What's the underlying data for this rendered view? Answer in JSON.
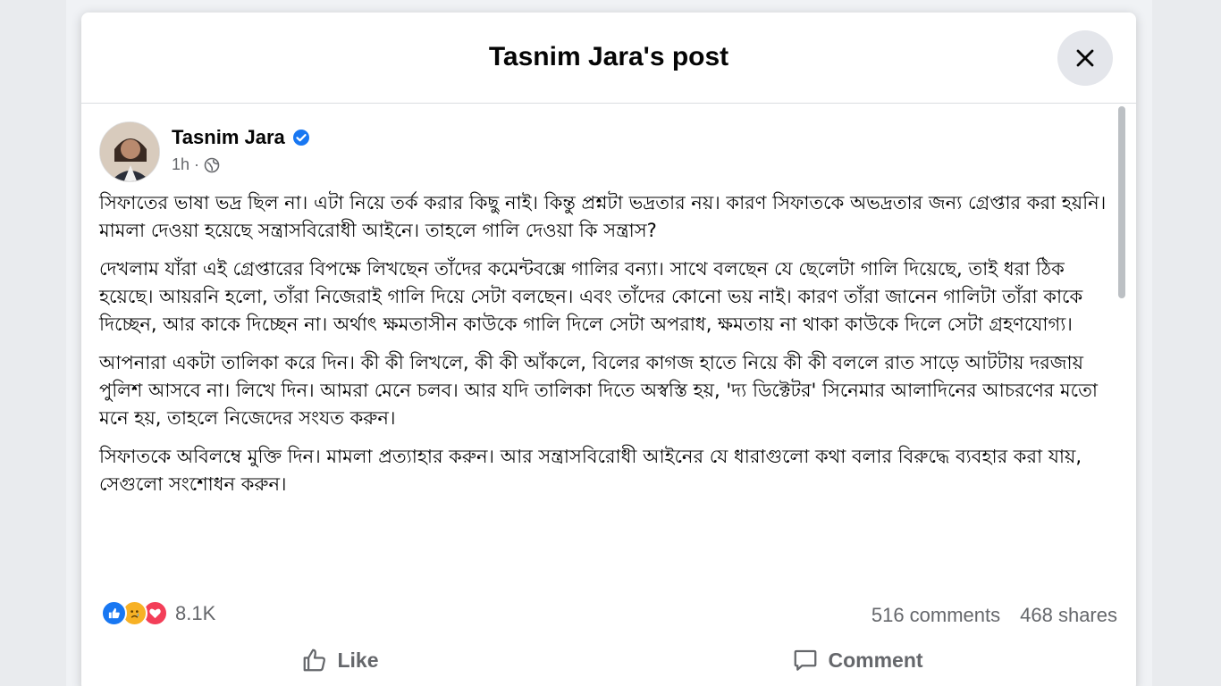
{
  "modal": {
    "title": "Tasnim Jara's post"
  },
  "post": {
    "author": "Tasnim Jara",
    "time": "1h",
    "separator": "·",
    "paragraphs": [
      "সিফাতের ভাষা ভদ্র ছিল না। এটা নিয়ে তর্ক করার কিছু নাই। কিন্তু প্রশ্নটা ভদ্রতার নয়। কারণ সিফাতকে অভদ্রতার জন্য গ্রেপ্তার করা হয়নি। মামলা দেওয়া হয়েছে সন্ত্রাসবিরোধী আইনে। তাহলে গালি দেওয়া কি সন্ত্রাস?",
      "দেখলাম যাঁরা এই গ্রেপ্তারের বিপক্ষে লিখছেন তাঁদের কমেন্টবক্সে গালির বন্যা। সাথে বলছেন যে ছেলেটা গালি দিয়েছে, তাই ধরা ঠিক হয়েছে। আয়রনি হলো, তাঁরা নিজেরাই গালি দিয়ে সেটা বলছেন। এবং তাঁদের কোনো ভয় নাই। কারণ তাঁরা জানেন গালিটা তাঁরা কাকে দিচ্ছেন, আর কাকে দিচ্ছেন না। অর্থাৎ ক্ষমতাসীন কাউকে গালি দিলে সেটা অপরাধ, ক্ষমতায় না থাকা কাউকে দিলে সেটা গ্রহণযোগ্য।",
      "আপনারা একটা তালিকা করে দিন। কী কী লিখলে, কী কী আঁকলে, বিলের কাগজ হাতে নিয়ে কী কী বললে রাত সাড়ে আটটায় দরজায় পুলিশ আসবে না। লিখে দিন। আমরা মেনে চলব। আর যদি তালিকা দিতে অস্বস্তি হয়, 'দ্য ডিক্টেটর' সিনেমার আলাদিনের আচরণের মতো মনে হয়, তাহলে নিজেদের সংযত করুন।",
      "সিফাতকে অবিলম্বে মুক্তি দিন। মামলা প্রত্যাহার করুন। আর সন্ত্রাসবিরোধী আইনের যে ধারাগুলো কথা বলার বিরুদ্ধে ব্যবহার করা যায়, সেগুলো সংশোধন করুন।"
    ]
  },
  "engagement": {
    "reaction_icons": [
      "like-icon",
      "sad-icon",
      "love-icon"
    ],
    "reaction_count": "8.1K",
    "comments": "516 comments",
    "shares": "468 shares"
  },
  "actions": {
    "like_label": "Like",
    "comment_label": "Comment"
  },
  "colors": {
    "accent": "#1877f2",
    "love": "#f33e58",
    "sad": "#f7b125",
    "muted": "#65676b"
  }
}
